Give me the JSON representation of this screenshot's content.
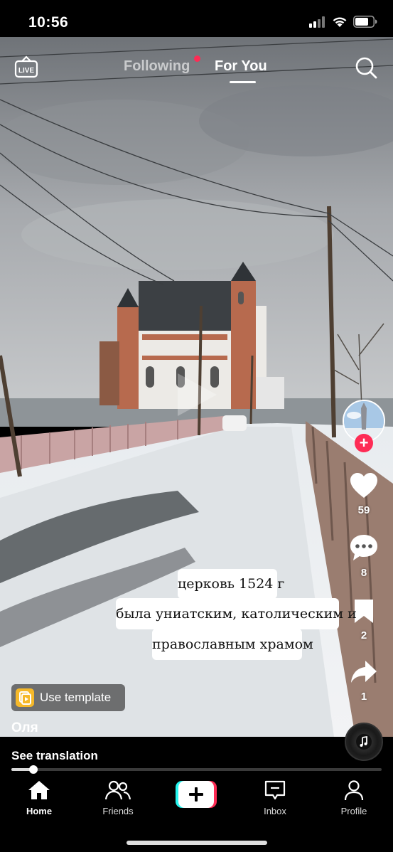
{
  "status_bar": {
    "time": "10:56"
  },
  "top_nav": {
    "live_label": "LIVE",
    "tabs": [
      {
        "label": "Following",
        "has_dot": true
      },
      {
        "label": "For You",
        "active": true
      }
    ]
  },
  "rail": {
    "like_count": "59",
    "comment_count": "8",
    "bookmark_count": "2",
    "share_count": "1",
    "follow_symbol": "+"
  },
  "caption_lines": [
    "церковь 1524 г",
    "была униатским, католическим и",
    "православным храмом"
  ],
  "use_template": {
    "label": "Use template"
  },
  "author": {
    "username": "Оля"
  },
  "translation": {
    "label": "See translation"
  },
  "playback": {
    "progress": 0.06
  },
  "bottom_nav": {
    "items": [
      {
        "label": "Home",
        "icon": "home-icon",
        "active": true
      },
      {
        "label": "Friends",
        "icon": "friends-icon"
      },
      {
        "label": "",
        "icon": "plus-icon"
      },
      {
        "label": "Inbox",
        "icon": "inbox-icon"
      },
      {
        "label": "Profile",
        "icon": "profile-icon"
      }
    ]
  },
  "colors": {
    "accent": "#fe2c55",
    "cyan": "#25f4ee",
    "template": "#f5b829"
  }
}
